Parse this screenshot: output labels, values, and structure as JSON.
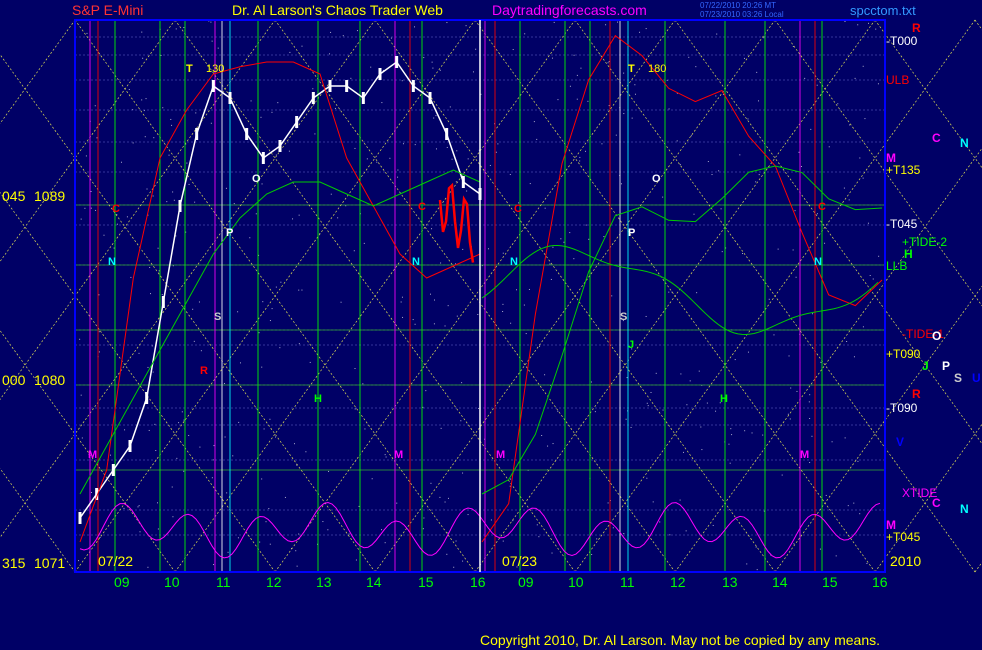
{
  "header": {
    "instrument": "S&P E-Mini",
    "title": "Dr. Al Larson's Chaos Trader Web",
    "site": "Daytradingforecasts.com",
    "timestamp1": "07/22/2010 20:26 MT",
    "timestamp2": "07/23/2010 03:26 Local",
    "file": "spcctom.txt"
  },
  "footer": {
    "copyright": "Copyright 2010, Dr. Al Larson. May not be copied by any means.",
    "year": "2010"
  },
  "colors": {
    "background": "#000066",
    "frame": "#0000ff",
    "price_bars": "#ffffff",
    "red_line": "#ff0000",
    "green_line": "#00cc00",
    "magenta_line": "#ff00ff",
    "yellow_grid": "#ffff66",
    "time_labels": "#00ff00"
  },
  "chart_data": {
    "type": "line",
    "y_left_labels": [
      {
        "deg": "045",
        "price": "1089",
        "value": 1089
      },
      {
        "deg": "000",
        "price": "1080",
        "value": 1080
      },
      {
        "deg": "315",
        "price": "1071",
        "value": 1071
      }
    ],
    "ylim": [
      1071,
      1093.5
    ],
    "x_ticks": [
      "09",
      "10",
      "11",
      "12",
      "13",
      "14",
      "15",
      "16",
      "09",
      "10",
      "11",
      "12",
      "13",
      "14",
      "15",
      "16"
    ],
    "date_labels": [
      "07/22",
      "07/23"
    ],
    "right_labels": [
      {
        "text": "-T000",
        "color": "#ffffff"
      },
      {
        "text": "ULB",
        "color": "#ff0000"
      },
      {
        "text": "+T135",
        "color": "#ffff00"
      },
      {
        "text": "-T045",
        "color": "#ffffff"
      },
      {
        "text": "+TIDE-2",
        "color": "#00ff00"
      },
      {
        "text": "LLB",
        "color": "#00ff00"
      },
      {
        "text": "-TIDE-1",
        "color": "#ff0000"
      },
      {
        "text": "+T090",
        "color": "#ffff00"
      },
      {
        "text": "-T090",
        "color": "#ffffff"
      },
      {
        "text": "XTIDE",
        "color": "#ff00ff"
      },
      {
        "text": "+T045",
        "color": "#ffff00"
      }
    ],
    "right_letters": [
      "R",
      "C",
      "N",
      "M",
      "H",
      "O",
      "J",
      "P",
      "S",
      "U",
      "R",
      "V",
      "C",
      "N",
      "M"
    ],
    "chart_letters": [
      {
        "text": "T",
        "note": "130"
      },
      {
        "text": "O"
      },
      {
        "text": "P"
      },
      {
        "text": "C"
      },
      {
        "text": "N"
      },
      {
        "text": "S"
      },
      {
        "text": "R"
      },
      {
        "text": "H"
      },
      {
        "text": "M"
      },
      {
        "text": "N"
      },
      {
        "text": "C"
      },
      {
        "text": "M"
      },
      {
        "text": "T",
        "note": "180"
      },
      {
        "text": "O"
      },
      {
        "text": "P"
      },
      {
        "text": "C"
      },
      {
        "text": "N"
      },
      {
        "text": "S"
      },
      {
        "text": "J"
      },
      {
        "text": "H"
      },
      {
        "text": "M"
      },
      {
        "text": "C"
      },
      {
        "text": "N"
      },
      {
        "text": "M"
      }
    ],
    "series": [
      {
        "name": "price",
        "color": "#ffffff",
        "values": [
          1073,
          1074,
          1075,
          1076,
          1078,
          1082,
          1086,
          1089,
          1091,
          1090.5,
          1089,
          1088,
          1088.5,
          1089.5,
          1090.5,
          1091,
          1091,
          1090.5,
          1091.5,
          1092,
          1091,
          1090.5,
          1089,
          1087,
          1086.5
        ]
      },
      {
        "name": "ULB",
        "color": "#ff0000",
        "values": [
          1072,
          1075,
          1083,
          1088,
          1090,
          1091.5,
          1091.8,
          1092,
          1092,
          1091.5,
          1088,
          1086,
          1084,
          1083,
          1083.5,
          1084
        ]
      },
      {
        "name": "LLB",
        "color": "#00cc00",
        "values": [
          1074,
          1076,
          1078,
          1080,
          1082,
          1084,
          1085.5,
          1086.5,
          1087,
          1087,
          1086.5,
          1086,
          1086.5,
          1087,
          1087.5,
          1087
        ]
      }
    ]
  }
}
